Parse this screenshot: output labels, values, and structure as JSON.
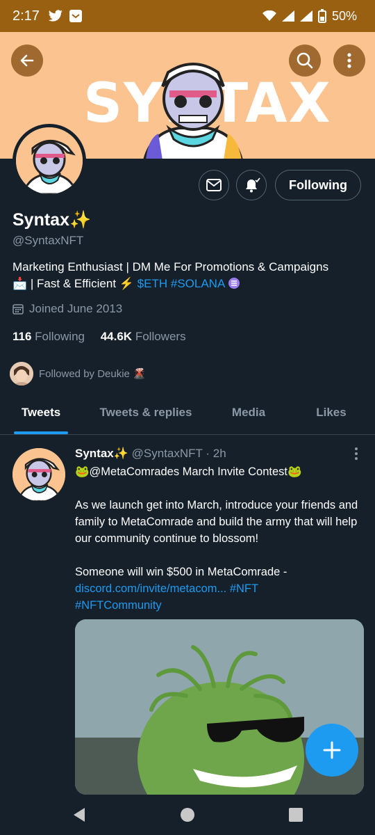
{
  "status": {
    "time": "2:17",
    "battery": "50%"
  },
  "banner": {
    "text": "SYNTAX"
  },
  "profile": {
    "name": "Syntax✨",
    "handle": "@SyntaxNFT",
    "bio_line1": "Marketing Enthusiast | DM Me For Promotions & Campaigns",
    "bio_line2_prefix": "📩 | Fast & Efficient ⚡ ",
    "bio_tag1": "$ETH",
    "bio_tag2": "#SOLANA",
    "joined": "Joined June 2013",
    "following_count": "116",
    "following_label": "Following",
    "followers_count": "44.6K",
    "followers_label": "Followers",
    "followed_by": "Followed by Deukie 🌋"
  },
  "actions": {
    "following_button": "Following"
  },
  "tabs": [
    {
      "label": "Tweets"
    },
    {
      "label": "Tweets & replies"
    },
    {
      "label": "Media"
    },
    {
      "label": "Likes"
    }
  ],
  "tweet": {
    "name": "Syntax✨",
    "handle": "@SyntaxNFT",
    "time": "· 2h",
    "line1": "🐸@MetaComrades March Invite Contest🐸",
    "para1": "As we launch get into March, introduce your friends and family to MetaComrade and build the army that will help our community continue to blossom!",
    "para2_text": "Someone will win $500 in MetaComrade -",
    "link": "discord.com/invite/metacom...",
    "tag1": "#NFT",
    "tag2": "#NFTCommunity"
  },
  "colors": {
    "accent": "#1d9bf0",
    "background": "#15202b",
    "banner": "#fbc38f"
  },
  "icons": [
    "back-arrow-icon",
    "search-icon",
    "more-vertical-icon",
    "mail-icon",
    "bell-plus-icon",
    "calendar-icon",
    "compose-plus-icon"
  ]
}
